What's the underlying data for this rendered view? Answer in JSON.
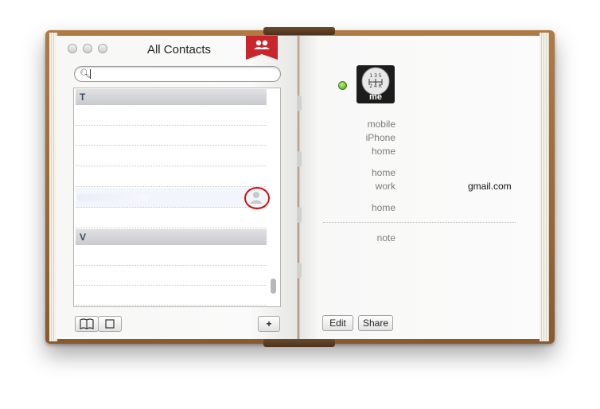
{
  "window": {
    "title": "All Contacts"
  },
  "search": {
    "placeholder": ""
  },
  "list": {
    "sections": [
      {
        "letter": "T"
      },
      {
        "letter": "V"
      }
    ]
  },
  "toolbar_left": {
    "add_label": "+"
  },
  "card": {
    "avatar_label": "me",
    "fields": [
      {
        "label": "mobile",
        "value": ""
      },
      {
        "label": "iPhone",
        "value": ""
      },
      {
        "label": "home",
        "value": ""
      },
      {
        "label": "home",
        "value": ""
      },
      {
        "label": "work",
        "value": "gmail.com"
      },
      {
        "label": "home",
        "value": ""
      },
      {
        "label": "note",
        "value": ""
      }
    ],
    "edit_label": "Edit",
    "share_label": "Share"
  },
  "colors": {
    "status": "#4aa019",
    "ribbon": "#c8262c",
    "annotation": "#d01010"
  }
}
